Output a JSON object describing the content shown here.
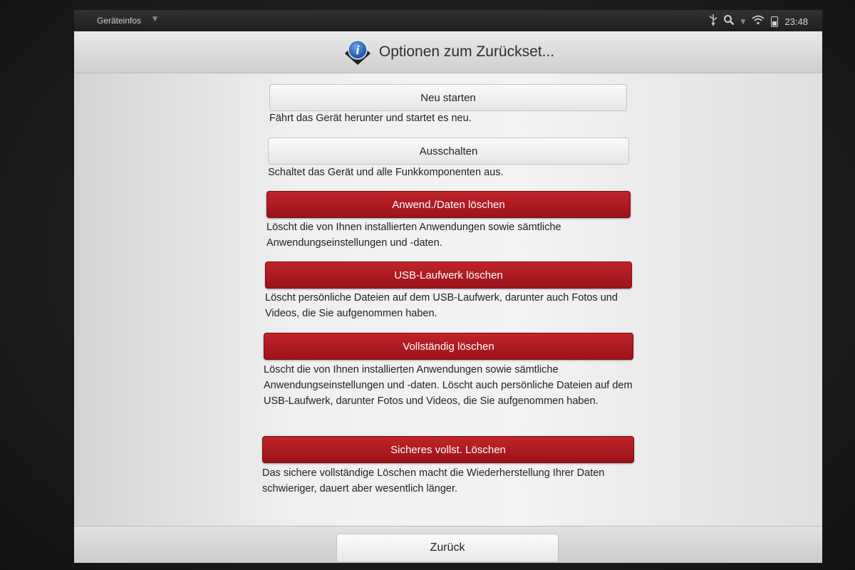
{
  "statusbar": {
    "app_name": "Geräteinfos",
    "clock": "23:48",
    "icons": [
      "usb-icon",
      "search-icon",
      "wifi-icon",
      "battery-icon"
    ]
  },
  "header": {
    "title": "Optionen zum Zurückset...",
    "icon": "info-icon"
  },
  "options": [
    {
      "label": "Neu starten",
      "description": "Fährt das Gerät herunter und startet es neu.",
      "style": "light"
    },
    {
      "label": "Ausschalten",
      "description": "Schaltet das Gerät und alle Funkkomponenten aus.",
      "style": "light"
    },
    {
      "label": "Anwend./Daten löschen",
      "description": "Löscht die von Ihnen installierten Anwendungen sowie sämtliche Anwendungseinstellungen und -daten.",
      "style": "red"
    },
    {
      "label": "USB-Laufwerk löschen",
      "description": "Löscht persönliche Dateien auf dem USB-Laufwerk, darunter auch Fotos und Videos, die Sie aufgenommen haben.",
      "style": "red"
    },
    {
      "label": "Vollständig löschen",
      "description": "Löscht die von Ihnen installierten Anwendungen sowie sämtliche Anwendungseinstellungen und -daten. Löscht auch persönliche Dateien auf dem USB-Laufwerk, darunter Fotos und Videos, die Sie aufgenommen haben.",
      "style": "red"
    },
    {
      "label": "Sicheres vollst. Löschen",
      "description": "Das sichere vollständige Löschen macht die Wiederherstellung Ihrer Daten schwieriger, dauert aber wesentlich länger.",
      "style": "red"
    }
  ],
  "footer": {
    "back_label": "Zurück"
  },
  "colors": {
    "danger": "#b01c22",
    "header_icon": "#2a6bbf"
  }
}
